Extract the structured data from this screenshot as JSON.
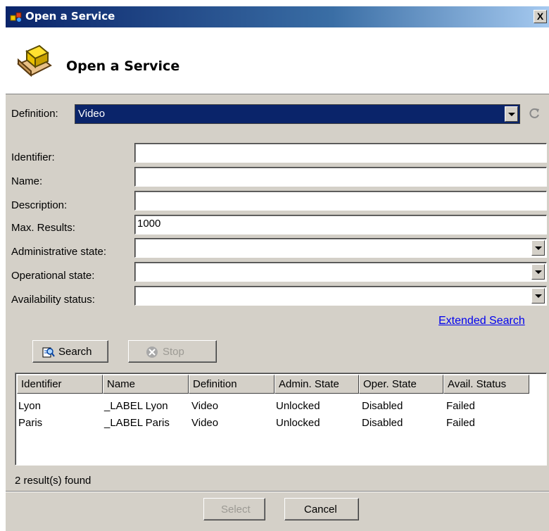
{
  "window": {
    "title": "Open a Service",
    "close_label": "X"
  },
  "header": {
    "heading": "Open a Service"
  },
  "definition": {
    "label": "Definition:",
    "value": "Video"
  },
  "form": {
    "identifier_label": "Identifier:",
    "identifier_value": "",
    "name_label": "Name:",
    "name_value": "",
    "description_label": "Description:",
    "description_value": "",
    "max_results_label": "Max. Results:",
    "max_results_value": "1000",
    "admin_state_label": "Administrative state:",
    "admin_state_value": "",
    "oper_state_label": "Operational state:",
    "oper_state_value": "",
    "avail_status_label": "Availability status:",
    "avail_status_value": ""
  },
  "extended_search_label": "Extended Search",
  "buttons": {
    "search": "Search",
    "stop": "Stop",
    "select": "Select",
    "cancel": "Cancel"
  },
  "table": {
    "headers": [
      "Identifier",
      "Name",
      "Definition",
      "Admin. State",
      "Oper. State",
      "Avail. Status"
    ],
    "rows": [
      [
        "Lyon",
        "_LABEL Lyon",
        "Video",
        "Unlocked",
        "Disabled",
        "Failed"
      ],
      [
        "Paris",
        "_LABEL Paris",
        "Video",
        "Unlocked",
        "Disabled",
        "Failed"
      ]
    ]
  },
  "status_text": "2 result(s) found",
  "colors": {
    "selection": "#0a246a",
    "dialog_bg": "#d4d0c8",
    "link": "#0000ee"
  }
}
